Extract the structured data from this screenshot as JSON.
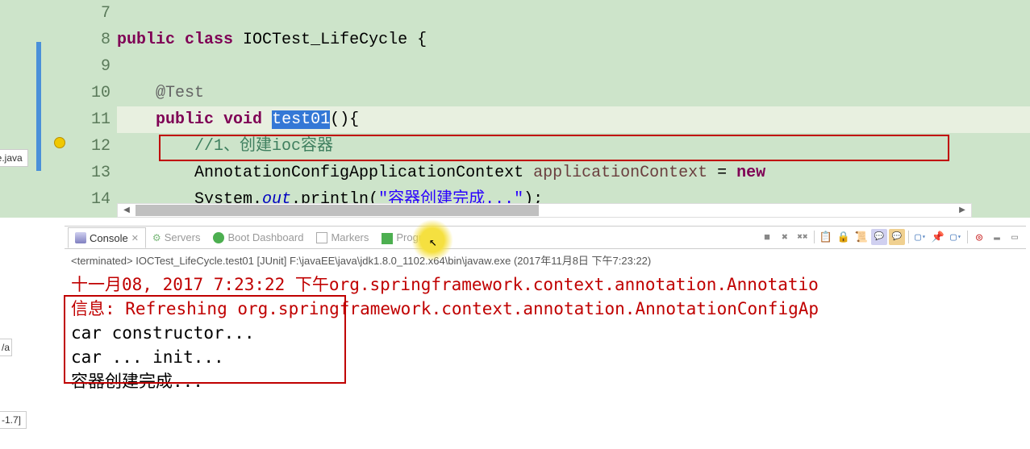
{
  "left_tabs": {
    "file1": "cle.java",
    "file2": "-1.7]",
    "file_side": "/a"
  },
  "lines": {
    "n7": "7",
    "n8": "8",
    "n9": "9",
    "n10": "10",
    "n11": "11",
    "n12": "12",
    "n13": "13",
    "n14": "14"
  },
  "code": {
    "l8_public": "public",
    "l8_class": "class",
    "l8_name": " IOCTest_LifeCycle {",
    "l10_ann": "@Test",
    "l11_public": "public",
    "l11_void": "void",
    "l11_name": "test01",
    "l11_rest": "(){",
    "l12_com": "//1、创建ioc容器",
    "l13_type": "AnnotationConfigApplicationContext ",
    "l13_var": "applicationContext",
    "l13_eq": " = ",
    "l13_new": "new",
    "l14_sys": "System.",
    "l14_out": "out",
    "l14_println": ".println(",
    "l14_str": "\"容器创建完成...\"",
    "l14_end": ");"
  },
  "tabs": {
    "console": "Console",
    "servers": "Servers",
    "boot": "Boot Dashboard",
    "markers": "Markers",
    "progress": "Progress"
  },
  "status": "<terminated> IOCTest_LifeCycle.test01 [JUnit] F:\\javaEE\\java\\jdk1.8.0_1102.x64\\bin\\javaw.exe (2017年11月8日 下午7:23:22)",
  "console": {
    "l1": "十一月08, 2017 7:23:22 下午org.springframework.context.annotation.Annotatio",
    "l2": "信息: Refreshing org.springframework.context.annotation.AnnotationConfigAp",
    "l3": "car constructor...",
    "l4": "car ... init...",
    "l5": "容器创建完成..."
  },
  "toolbar": {
    "stop": "■",
    "x": "✖",
    "xx": "✖✖",
    "clip": "📋",
    "lock": "🔒",
    "scroll": "📜",
    "speech1": "💬",
    "speech2": "💬",
    "new": "▢",
    "pin": "📌",
    "disp": "▢",
    "ring": "◎",
    "min": "▬",
    "max": "▭"
  }
}
